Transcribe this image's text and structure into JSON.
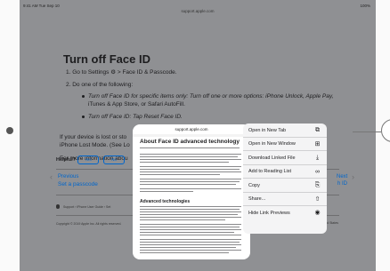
{
  "status_bar": {
    "time": "9:41 AM  Tue Sep 10",
    "battery": "100%"
  },
  "browser": {
    "url": "support.apple.com"
  },
  "article": {
    "heading": "Turn off Face ID",
    "step1": "1.  Go to Settings ⚙ > Face ID & Passcode.",
    "step2": "2.  Do one of the following:",
    "bullet1_a": "Turn off Face ID for specific items only: Turn off one or more options: iPhone Unlock, Apple Pay,",
    "bullet1_b": "iTunes & App Store, or Safari AutoFill.",
    "bullet2": "Turn off Face ID: Tap Reset Face ID.",
    "para1_a": "If your device is lost or sto",
    "para1_b": "iPhone Lost Mode. (See Lo",
    "para2": "For more information abou",
    "helpful": "Helpful?",
    "yes": "Yes",
    "no": "No",
    "previous": "Previous",
    "previous_title": "Set a passcode",
    "next": "Next",
    "next_title": "h ID",
    "footer_links": "Support  ›  iPhone User Guide  ›  Set",
    "copyright": "Copyright © 2019 Apple Inc. All rights reserved.",
    "region": "United States"
  },
  "preview": {
    "url": "support.apple.com",
    "title": "About Face ID advanced technology",
    "subheading": "Advanced technologies"
  },
  "context_menu": {
    "items": [
      {
        "label": "Open in New Tab",
        "icon": "new-tab-icon",
        "glyph": "⧉"
      },
      {
        "label": "Open in New Window",
        "icon": "new-window-icon",
        "glyph": "⊞"
      },
      {
        "label": "Download Linked File",
        "icon": "download-icon",
        "glyph": "⤓"
      },
      {
        "label": "Add to Reading List",
        "icon": "glasses-icon",
        "glyph": "∞"
      },
      {
        "label": "Copy",
        "icon": "copy-icon",
        "glyph": "⎘"
      },
      {
        "label": "Share...",
        "icon": "share-icon",
        "glyph": "⇧"
      },
      {
        "label": "Hide Link Previews",
        "icon": "eye-icon",
        "glyph": "◉"
      }
    ]
  },
  "colors": {
    "link": "#0066cc",
    "dim_overlay": "#8f9093",
    "menu_bg": "#f4f4f5"
  }
}
